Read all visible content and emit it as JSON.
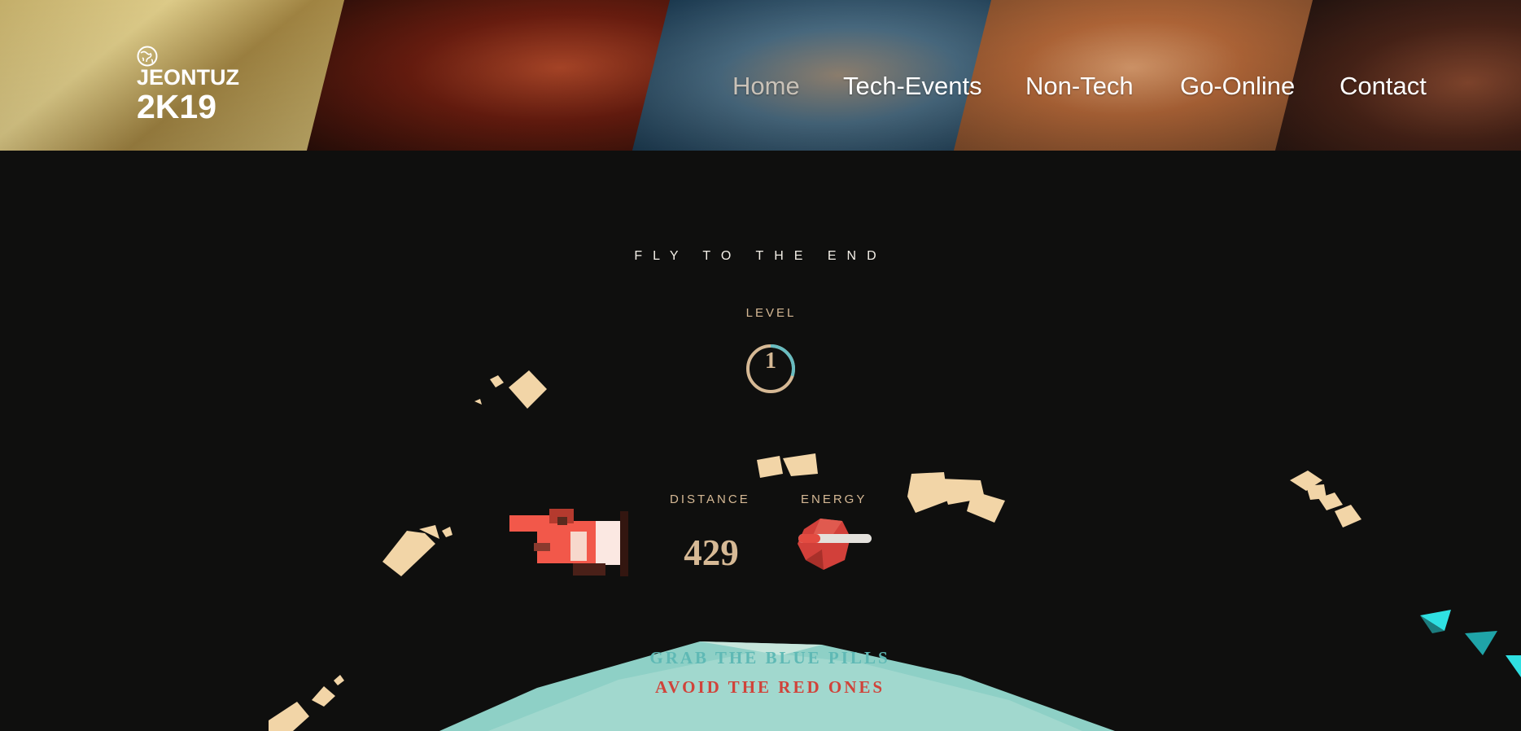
{
  "header": {
    "logo_line1": "JEONTUZ",
    "logo_line2": "2K19",
    "nav": [
      {
        "label": "Home",
        "active": true
      },
      {
        "label": "Tech-Events",
        "active": false
      },
      {
        "label": "Non-Tech",
        "active": false
      },
      {
        "label": "Go-Online",
        "active": false
      },
      {
        "label": "Contact",
        "active": false
      }
    ]
  },
  "game": {
    "title": "FLY TO THE END",
    "level_label": "LEVEL",
    "level": "1",
    "level_progress": 0.3,
    "distance_label": "DISTANCE",
    "distance": "429",
    "energy_label": "ENERGY",
    "energy": 0.3,
    "hint_blue": "GRAB THE BLUE PILLS",
    "hint_red": "AVOID THE RED ONES"
  },
  "colors": {
    "background": "#0f0f0e",
    "accent_tan": "#d6b995",
    "level_ring_progress": "#68bcc0",
    "energy_fill": "#e34b41",
    "hint_blue": "#5fb9b5",
    "hint_red": "#d0433a"
  },
  "icons": [
    "globe-icon",
    "red-plane",
    "red-pill",
    "blue-pill"
  ]
}
